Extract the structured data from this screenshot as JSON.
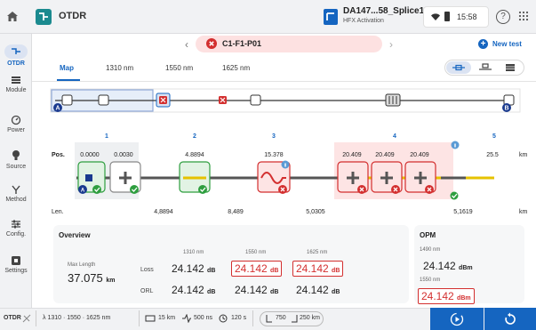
{
  "header": {
    "app_title": "OTDR",
    "file_name": "DA147...58_Splice1",
    "file_subtitle": "HFX Activation",
    "time": "15:58",
    "help_label": "?"
  },
  "sidebar": {
    "items": [
      {
        "label": "OTDR",
        "icon": "otdr-icon",
        "active": true
      },
      {
        "label": "Module",
        "icon": "module-icon"
      },
      {
        "label": "Power",
        "icon": "power-icon"
      },
      {
        "label": "Source",
        "icon": "source-icon"
      },
      {
        "label": "Method",
        "icon": "method-icon"
      },
      {
        "label": "Config.",
        "icon": "config-icon"
      },
      {
        "label": "Settings",
        "icon": "settings-icon"
      }
    ]
  },
  "trace": {
    "name": "C1-F1-P01",
    "new_test_label": "New test"
  },
  "tabs": [
    {
      "label": "Map",
      "active": true
    },
    {
      "label": "1310 nm"
    },
    {
      "label": "1550 nm"
    },
    {
      "label": "1625 nm"
    }
  ],
  "map": {
    "pos_label": "Pos.",
    "len_label": "Len.",
    "unit": "km",
    "event_numbers": [
      "1",
      "2",
      "3",
      "4",
      "5"
    ],
    "positions": [
      "0.0000",
      "0.0030",
      "4.8894",
      "15.378",
      "20.409",
      "20.409",
      "20.409",
      "25.5"
    ],
    "lengths": [
      "4,8894",
      "8,489",
      "5,0305",
      "5,1619"
    ],
    "markers": {
      "start": "A",
      "end": "B"
    }
  },
  "overview": {
    "title": "Overview",
    "max_length_label": "Max Length",
    "max_length_value": "37.075",
    "max_length_unit": "km",
    "columns": [
      "1310 nm",
      "1550 nm",
      "1625 nm"
    ],
    "loss_label": "Loss",
    "orl_label": "ORL",
    "loss_values": [
      "24.142",
      "24.142",
      "24.142"
    ],
    "orl_values": [
      "24.142",
      "24.142",
      "24.142"
    ],
    "unit_db": "dB"
  },
  "opm": {
    "title": "OPM",
    "rows": [
      {
        "wavelength": "1490 nm",
        "value": "24.142",
        "unit": "dBm",
        "fail": false
      },
      {
        "wavelength": "1550 nm",
        "value": "24.142",
        "unit": "dBm",
        "fail": true
      }
    ]
  },
  "bottombar": {
    "mode": "OTDR",
    "wavelengths": "λ  1310 · 1550 · 1625 nm",
    "range": "15 km",
    "pulse": "500 ns",
    "duration": "120 s",
    "distance": "750",
    "distance2": "250 km"
  },
  "colors": {
    "accent": "#1565c0",
    "fail": "#d32f2f",
    "pass": "#2e9e3f",
    "teal": "#1b8a8f"
  }
}
